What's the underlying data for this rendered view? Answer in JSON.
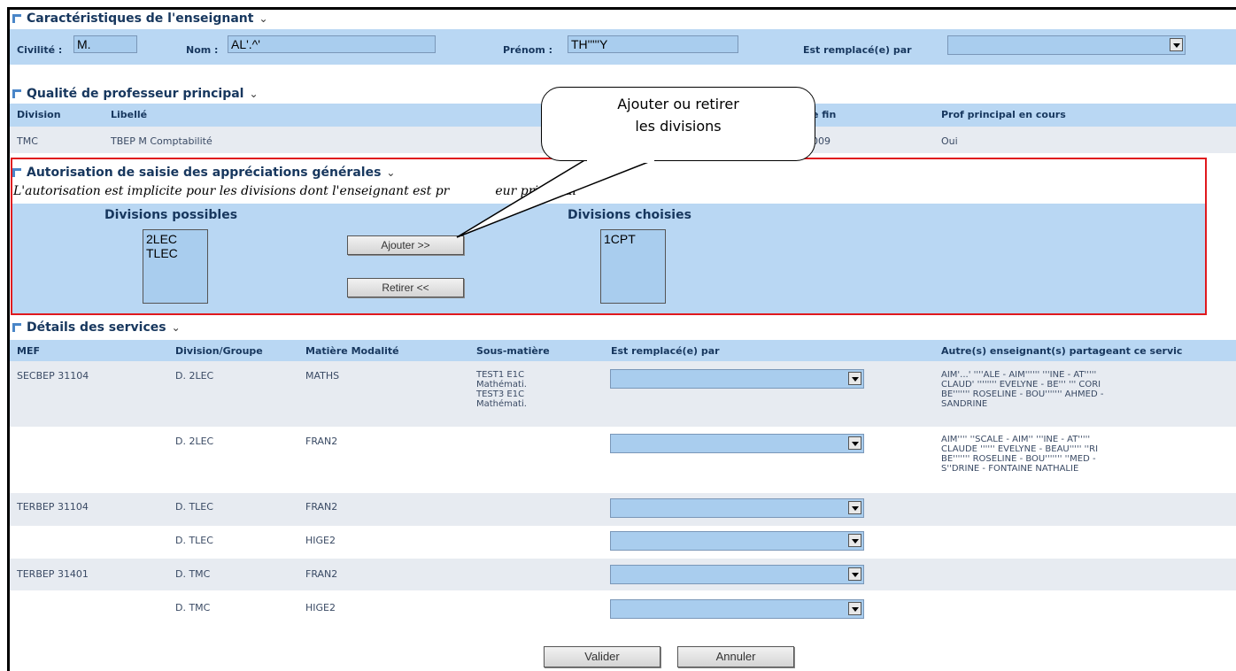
{
  "teacher": {
    "title": "Caractéristiques de l'enseignant",
    "civilite_label": "Civilité :",
    "civilite_value": "M.",
    "nom_label": "Nom :",
    "nom_value": "AL'.^'",
    "prenom_label": "Prénom :",
    "prenom_value": "TH'''''Y",
    "remplace_label": "Est remplacé(e) par",
    "remplace_value": ""
  },
  "principal": {
    "title": "Qualité de professeur principal",
    "headers": {
      "division": "Division",
      "libelle": "Libellé",
      "fin": "e fin",
      "encours": "Prof principal en cours"
    },
    "row": {
      "division": "TMC",
      "libelle": "TBEP M Comptabilité",
      "fin": "009",
      "encours": "Oui"
    }
  },
  "authorization": {
    "title": "Autorisation de saisie des appréciations générales",
    "note": "L'autorisation est implicite pour les divisions dont l'enseignant est pr",
    "note_end": "eur principal",
    "possible_label": "Divisions possibles",
    "possible_items": [
      "2LEC",
      "TLEC"
    ],
    "chosen_label": "Divisions choisies",
    "chosen_items": [
      "1CPT"
    ],
    "add_button": "Ajouter >>",
    "remove_button": "Retirer <<"
  },
  "callout": {
    "line1": "Ajouter ou retirer",
    "line2": "les divisions"
  },
  "services": {
    "title": "Détails des services",
    "headers": {
      "mef": "MEF",
      "division": "Division/Groupe",
      "matiere": "Matière Modalité",
      "sous": "Sous-matière",
      "remplace": "Est remplacé(e) par",
      "autres": "Autre(s) enseignant(s) partageant ce servic"
    },
    "rows": [
      {
        "mef": "SECBEP 31104",
        "division": "D. 2LEC",
        "matiere": "MATHS",
        "sous": [
          "TEST1 E1C",
          "Mathémati.",
          "TEST3 E1C",
          "Mathémati."
        ],
        "autres": [
          "AIM'...' ''''ALE - AIM'''''' '''INE - AT'''''",
          "CLAUD' '''''''' EVELYNE - BE''' ''' CORI",
          "BE''''''' ROSELINE - BOU''''''' AHMED -",
          "SANDRINE"
        ]
      },
      {
        "mef": "",
        "division": "D. 2LEC",
        "matiere": "FRAN2",
        "sous": [],
        "autres": [
          "AIM'''' ''SCALE - AIM'' '''INE - AT'''''",
          "CLAUDE '''''' EVELYNE - BEAU''''' ''RI",
          "BE''''''' ROSELINE - BOU''''''' ''MED -",
          "S''DRINE - FONTAINE NATHALIE"
        ]
      },
      {
        "mef": "TERBEP 31104",
        "division": "D. TLEC",
        "matiere": "FRAN2",
        "sous": [],
        "autres": []
      },
      {
        "mef": "",
        "division": "D. TLEC",
        "matiere": "HIGE2",
        "sous": [],
        "autres": []
      },
      {
        "mef": "TERBEP 31401",
        "division": "D. TMC",
        "matiere": "FRAN2",
        "sous": [],
        "autres": []
      },
      {
        "mef": "",
        "division": "D. TMC",
        "matiere": "HIGE2",
        "sous": [],
        "autres": []
      }
    ]
  },
  "footer": {
    "validate": "Valider",
    "cancel": "Annuler"
  },
  "colors": {
    "band": "#b9d7f3",
    "field": "#a9cdee",
    "highlight": "#e0191e",
    "title": "#17375e"
  }
}
